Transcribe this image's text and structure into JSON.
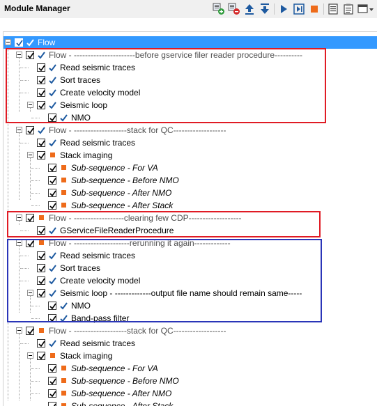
{
  "header": {
    "title": "Module Manager"
  },
  "toolbar": {
    "buttons": [
      {
        "icon": "add-module-icon"
      },
      {
        "icon": "remove-module-icon"
      },
      {
        "icon": "move-up-icon"
      },
      {
        "icon": "move-down-icon"
      },
      {
        "icon": "run-icon"
      },
      {
        "icon": "step-run-icon"
      },
      {
        "icon": "stop-icon"
      },
      {
        "icon": "notes-icon"
      },
      {
        "icon": "clipboard-icon"
      },
      {
        "icon": "window-options-icon"
      }
    ]
  },
  "colors": {
    "selection": "#3399ff",
    "check_blue": "#1e5aa0",
    "orange_marker": "#ee6b1a",
    "red_box": "#e01b24",
    "blue_box": "#2a35b8"
  },
  "tree": {
    "rows": [
      {
        "label": "Flow",
        "kind": "flow",
        "marker": "check"
      },
      {
        "label": "Flow - ----------------------before gservice filer reader procedure----------",
        "kind": "flow",
        "marker": "check"
      },
      {
        "label": "Read seismic traces",
        "kind": "module",
        "marker": "check"
      },
      {
        "label": "Sort traces",
        "kind": "module",
        "marker": "check"
      },
      {
        "label": "Create velocity model",
        "kind": "module",
        "marker": "check"
      },
      {
        "label": "Seismic loop",
        "kind": "module",
        "marker": "check"
      },
      {
        "label": "NMO",
        "kind": "module",
        "marker": "check"
      },
      {
        "label": "Flow - -------------------stack for QC-------------------",
        "kind": "flow",
        "marker": "check"
      },
      {
        "label": "Read seismic traces",
        "kind": "module",
        "marker": "check"
      },
      {
        "label": "Stack imaging",
        "kind": "module",
        "marker": "square"
      },
      {
        "label": "Sub-sequence - For VA",
        "kind": "subseq",
        "marker": "square"
      },
      {
        "label": "Sub-sequence - Before NMO",
        "kind": "subseq",
        "marker": "square"
      },
      {
        "label": "Sub-sequence - After NMO",
        "kind": "subseq",
        "marker": "square"
      },
      {
        "label": "Sub-sequence - After Stack",
        "kind": "subseq",
        "marker": "square"
      },
      {
        "label": "Flow - ------------------clearing few CDP-------------------",
        "kind": "flow",
        "marker": "square"
      },
      {
        "label": "GServiceFileReaderProcedure",
        "kind": "module",
        "marker": "check"
      },
      {
        "label": "Flow - --------------------rerunning it again-------------",
        "kind": "flow",
        "marker": "square"
      },
      {
        "label": "Read seismic traces",
        "kind": "module",
        "marker": "check"
      },
      {
        "label": "Sort traces",
        "kind": "module",
        "marker": "check"
      },
      {
        "label": "Create velocity model",
        "kind": "module",
        "marker": "check"
      },
      {
        "label": "Seismic loop - -------------output file name should remain same-----",
        "kind": "module",
        "marker": "check"
      },
      {
        "label": "NMO",
        "kind": "module",
        "marker": "check"
      },
      {
        "label": "Band-pass filter",
        "kind": "module",
        "marker": "check"
      },
      {
        "label": "Flow - -------------------stack for QC-------------------",
        "kind": "flow",
        "marker": "square"
      },
      {
        "label": "Read seismic traces",
        "kind": "module",
        "marker": "check"
      },
      {
        "label": "Stack imaging",
        "kind": "module",
        "marker": "square"
      },
      {
        "label": "Sub-sequence - For VA",
        "kind": "subseq",
        "marker": "square"
      },
      {
        "label": "Sub-sequence - Before NMO",
        "kind": "subseq",
        "marker": "square"
      },
      {
        "label": "Sub-sequence - After NMO",
        "kind": "subseq",
        "marker": "square"
      },
      {
        "label": "Sub-sequence - After Stack",
        "kind": "subseq",
        "marker": "square"
      }
    ]
  }
}
